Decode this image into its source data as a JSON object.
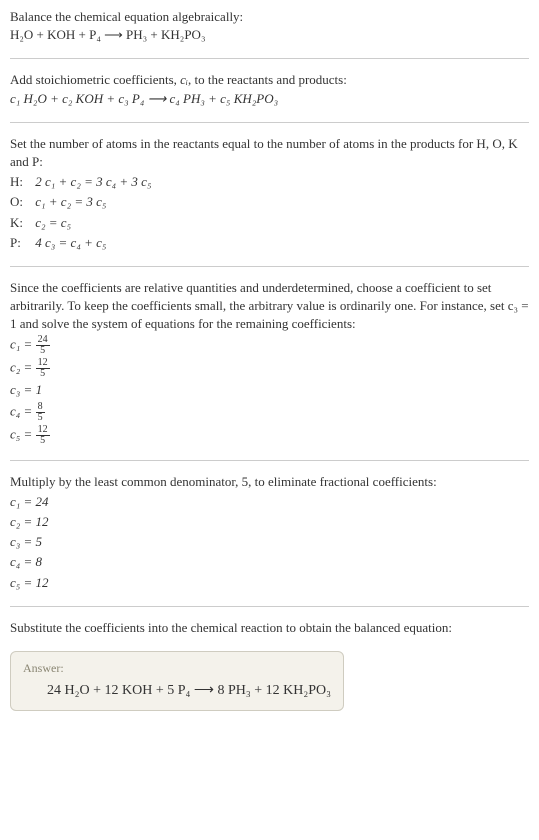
{
  "intro": {
    "line1": "Balance the chemical equation algebraically:",
    "eq": "H₂O + KOH + P₄  ⟶  PH₃ + KH₂PO₃"
  },
  "step2": {
    "text_a": "Add stoichiometric coefficients, ",
    "ci": "cᵢ",
    "text_b": ", to the reactants and products:",
    "eq": "c₁ H₂O + c₂ KOH + c₃ P₄  ⟶  c₄ PH₃ + c₅ KH₂PO₃"
  },
  "step3": {
    "text": "Set the number of atoms in the reactants equal to the number of atoms in the products for H, O, K and P:",
    "rows": [
      {
        "label": "H:",
        "eq": "2 c₁ + c₂ = 3 c₄ + 3 c₅"
      },
      {
        "label": "O:",
        "eq": "c₁ + c₂ = 3 c₅"
      },
      {
        "label": "K:",
        "eq": "c₂ = c₅"
      },
      {
        "label": "P:",
        "eq": "4 c₃ = c₄ + c₅"
      }
    ]
  },
  "step4": {
    "text": "Since the coefficients are relative quantities and underdetermined, choose a coefficient to set arbitrarily. To keep the coefficients small, the arbitrary value is ordinarily one. For instance, set c₃ = 1 and solve the system of equations for the remaining coefficients:",
    "rows": [
      {
        "lhs": "c₁ = ",
        "num": "24",
        "den": "5"
      },
      {
        "lhs": "c₂ = ",
        "num": "12",
        "den": "5"
      },
      {
        "lhs": "c₃ = ",
        "plain": "1"
      },
      {
        "lhs": "c₄ = ",
        "num": "8",
        "den": "5"
      },
      {
        "lhs": "c₅ = ",
        "num": "12",
        "den": "5"
      }
    ]
  },
  "step5": {
    "text": "Multiply by the least common denominator, 5, to eliminate fractional coefficients:",
    "rows": [
      {
        "eq": "c₁ = 24"
      },
      {
        "eq": "c₂ = 12"
      },
      {
        "eq": "c₃ = 5"
      },
      {
        "eq": "c₄ = 8"
      },
      {
        "eq": "c₅ = 12"
      }
    ]
  },
  "step6": {
    "text": "Substitute the coefficients into the chemical reaction to obtain the balanced equation:"
  },
  "answer": {
    "label": "Answer:",
    "eq": "24 H₂O + 12 KOH + 5 P₄  ⟶  8 PH₃ + 12 KH₂PO₃"
  }
}
